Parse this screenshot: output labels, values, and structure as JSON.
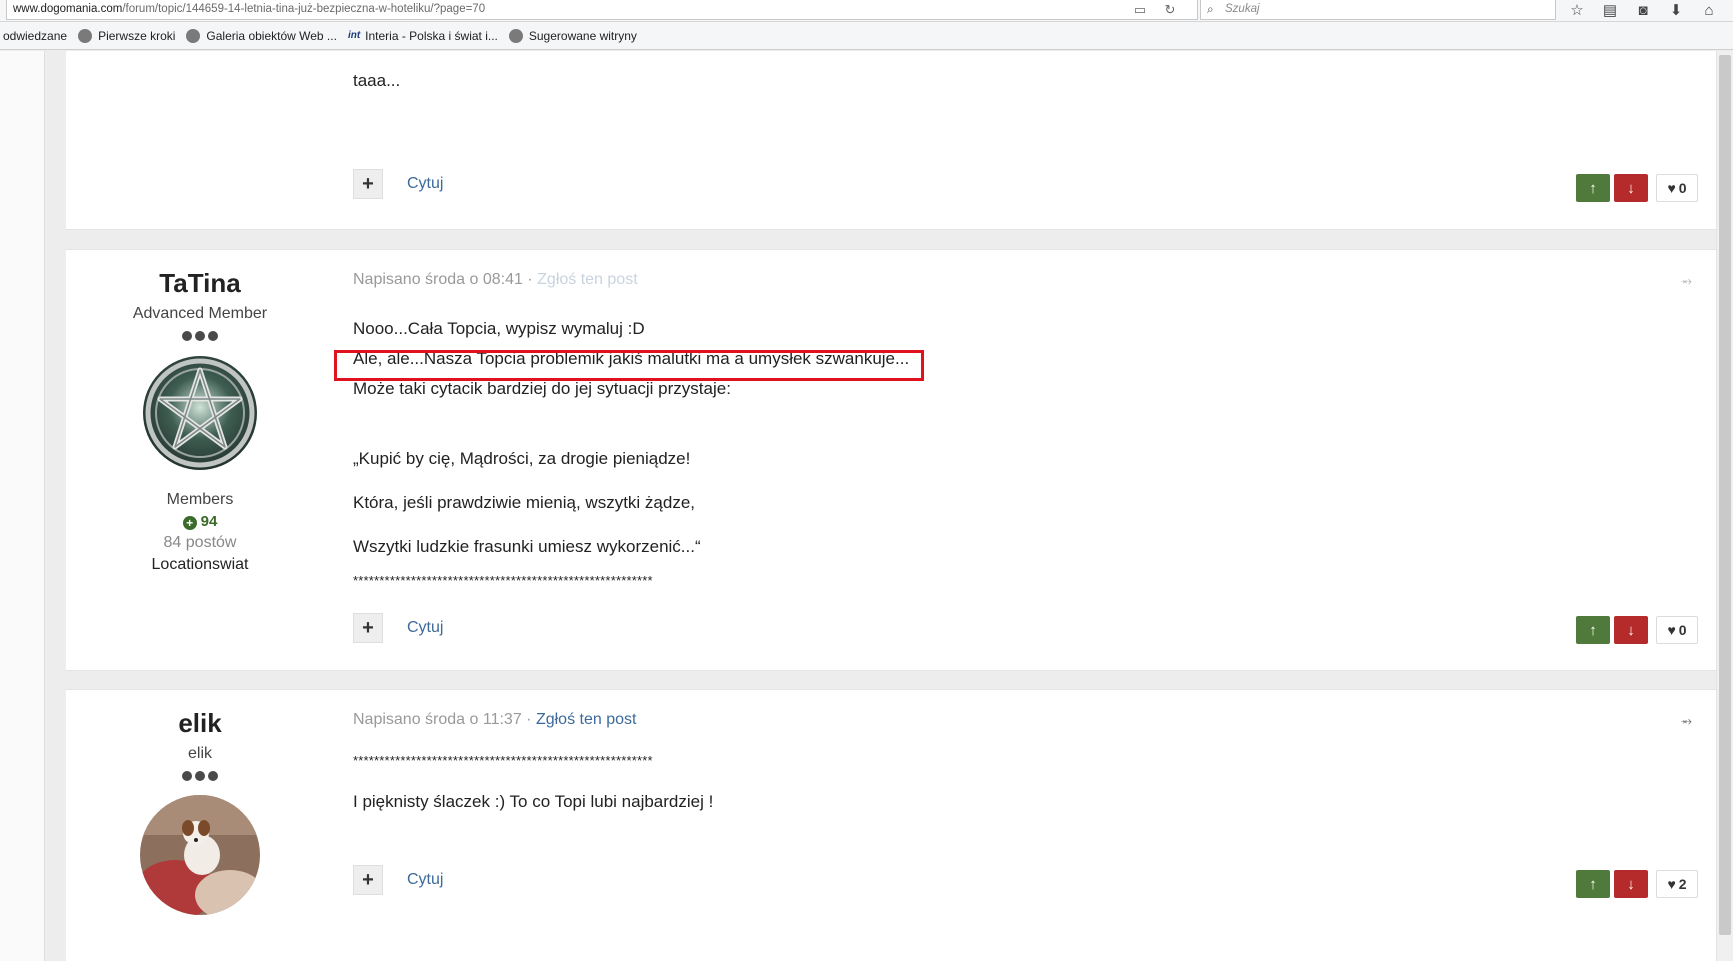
{
  "browser": {
    "url_host": "www.dogomania.com",
    "url_path": "/forum/topic/144659-14-letnia-tina-już-bezpieczna-w-hoteliku/?page=70",
    "search_placeholder": "Szukaj",
    "bookmarks": [
      {
        "label": "odwiedzane",
        "icon": "none"
      },
      {
        "label": "Pierwsze kroki",
        "icon": "globe-icon"
      },
      {
        "label": "Galeria obiektów Web ...",
        "icon": "globe-icon"
      },
      {
        "label": "Interia - Polska i świat i...",
        "icon": "interia-icon"
      },
      {
        "label": "Sugerowane witryny",
        "icon": "globe-icon"
      }
    ]
  },
  "common": {
    "quote_label": "Cytuj",
    "report_label": "Zgłoś ten post"
  },
  "posts": [
    {
      "body": [
        "taaa..."
      ],
      "likes": "0"
    },
    {
      "author": {
        "name": "TaTina",
        "title": "Advanced Member",
        "group": "Members",
        "reputation": "94",
        "post_count": "84 postów",
        "location": "Locationswiat"
      },
      "posted": "Napisano środa o 08:41",
      "body": [
        "Nooo...Cała Topcia, wypisz wymaluj :D",
        "Ale, ale...Nasza Topcia problemik jakiś malutki ma a umysłek szwankuje...",
        "Może taki cytacik bardziej do jej sytuacji przystaje:",
        "„Kupić by cię, Mądrości, za drogie pieniądze!",
        "Która, jeśli prawdziwie mienią, wszytki żądze,",
        "Wszytki ludzkie frasunki umiesz wykorzenić...“",
        "*********************************************************"
      ],
      "likes": "0"
    },
    {
      "author": {
        "name": "elik",
        "title": "elik"
      },
      "posted": "Napisano środa o 11:37",
      "body": [
        "*********************************************************",
        "I pięknisty ślaczek :) To co Topi lubi najbardziej !"
      ],
      "likes": "2"
    }
  ],
  "colors": {
    "vote_up": "#507a3b",
    "vote_down": "#b52a2a",
    "highlight_box": "#e0121d",
    "link": "#3d6a9a"
  }
}
